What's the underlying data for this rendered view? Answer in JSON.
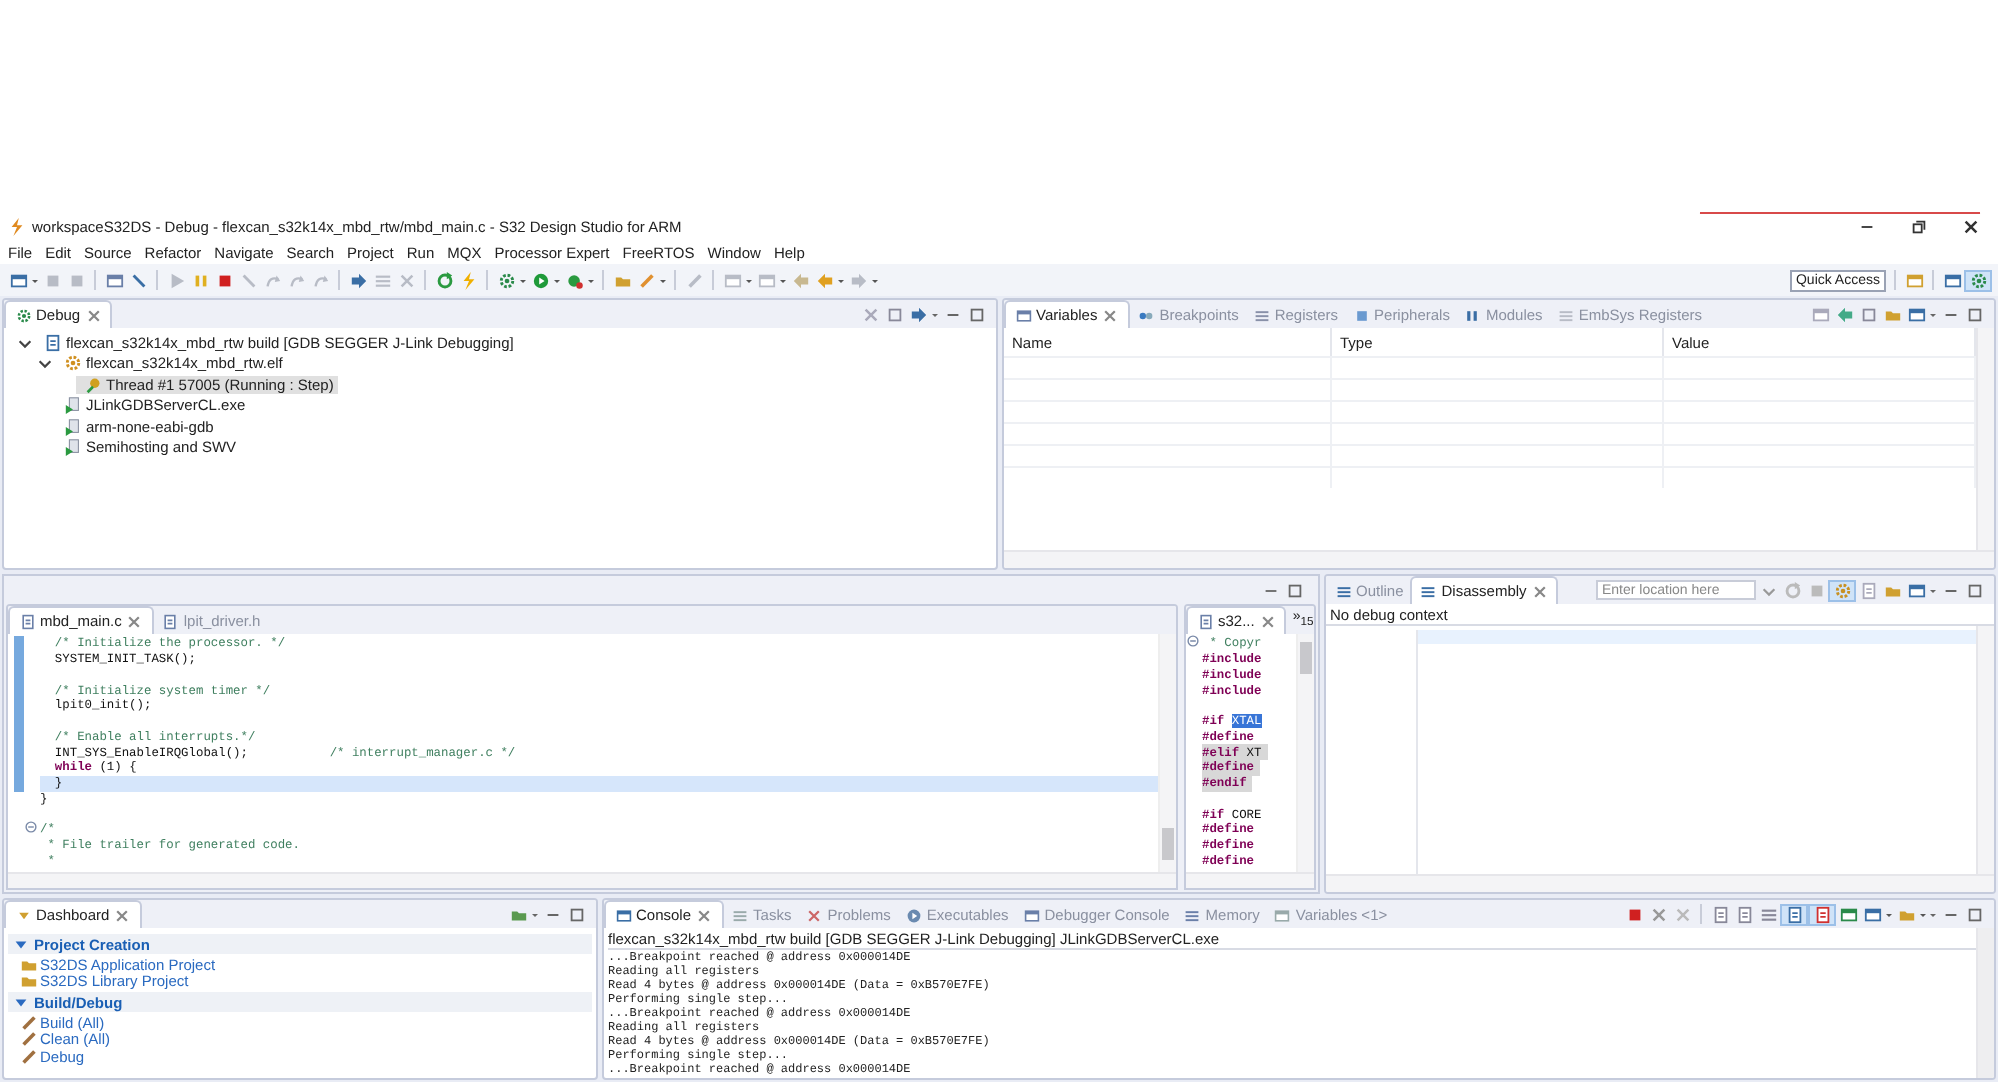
{
  "window": {
    "title": "workspaceS32DS - Debug - flexcan_s32k14x_mbd_rtw/mbd_main.c - S32 Design Studio for ARM"
  },
  "menu": [
    "File",
    "Edit",
    "Source",
    "Refactor",
    "Navigate",
    "Search",
    "Project",
    "Run",
    "MQX",
    "Processor Expert",
    "FreeRTOS",
    "Window",
    "Help"
  ],
  "toolbar": {
    "quick_access": "Quick Access"
  },
  "debug": {
    "tab": "Debug",
    "tree": [
      {
        "label": "flexcan_s32k14x_mbd_rtw build [GDB SEGGER J-Link Debugging]",
        "kind": "launch",
        "expanded": true,
        "selected": false,
        "children": [
          {
            "label": "flexcan_s32k14x_mbd_rtw.elf",
            "kind": "app",
            "expanded": true,
            "selected": false,
            "children": [
              {
                "label": "Thread #1 57005 (Running : Step)",
                "kind": "thread",
                "selected": true
              }
            ]
          },
          {
            "label": "JLinkGDBServerCL.exe",
            "kind": "process",
            "selected": false
          },
          {
            "label": "arm-none-eabi-gdb",
            "kind": "process",
            "selected": false
          },
          {
            "label": "Semihosting and SWV",
            "kind": "process",
            "selected": false
          }
        ]
      }
    ]
  },
  "variables": {
    "tabs": [
      {
        "label": "Variables",
        "selected": true
      },
      {
        "label": "Breakpoints",
        "selected": false
      },
      {
        "label": "Registers",
        "selected": false
      },
      {
        "label": "Peripherals",
        "selected": false
      },
      {
        "label": "Modules",
        "selected": false
      },
      {
        "label": "EmbSys Registers",
        "selected": false
      }
    ],
    "columns": [
      "Name",
      "Type",
      "Value"
    ]
  },
  "editor": {
    "tabs": [
      {
        "label": "mbd_main.c",
        "selected": true
      },
      {
        "label": "lpit_driver.h",
        "selected": false
      }
    ],
    "lines": [
      {
        "changed": true,
        "fold_marker": false,
        "highlighted": false,
        "segments": [
          {
            "text": "  /* Initialize the processor. */",
            "kind": "comment"
          }
        ]
      },
      {
        "changed": true,
        "fold_marker": false,
        "highlighted": false,
        "segments": [
          {
            "text": "  SYSTEM_INIT_TASK();",
            "kind": "plain"
          }
        ]
      },
      {
        "changed": true,
        "fold_marker": false,
        "highlighted": false
      },
      {
        "changed": true,
        "fold_marker": false,
        "highlighted": false,
        "segments": [
          {
            "text": "  /* Initialize system timer */",
            "kind": "comment"
          }
        ]
      },
      {
        "changed": true,
        "fold_marker": false,
        "highlighted": false,
        "segments": [
          {
            "text": "  lpit0_init();",
            "kind": "plain"
          }
        ]
      },
      {
        "changed": true,
        "fold_marker": false,
        "highlighted": false
      },
      {
        "changed": true,
        "fold_marker": false,
        "highlighted": false,
        "segments": [
          {
            "text": "  /* Enable all interrupts.*/",
            "kind": "comment"
          }
        ]
      },
      {
        "changed": true,
        "fold_marker": false,
        "highlighted": false,
        "segments": [
          {
            "text": "  INT_SYS_EnableIRQGlobal();           ",
            "kind": "plain"
          },
          {
            "text": "/* interrupt_manager.c */",
            "kind": "comment"
          }
        ]
      },
      {
        "changed": true,
        "fold_marker": false,
        "highlighted": false,
        "segments": [
          {
            "text": "  while",
            "kind": "keyword"
          },
          {
            "text": " (1) {",
            "kind": "plain"
          }
        ]
      },
      {
        "changed": true,
        "fold_marker": false,
        "highlighted": true,
        "segments": [
          {
            "text": "  }",
            "kind": "plain"
          }
        ]
      },
      {
        "changed": false,
        "fold_marker": false,
        "highlighted": false,
        "segments": [
          {
            "text": "}",
            "kind": "plain"
          }
        ]
      },
      {
        "changed": false,
        "fold_marker": false,
        "highlighted": false
      },
      {
        "changed": false,
        "fold_marker": true,
        "highlighted": false,
        "segments": [
          {
            "text": "/*",
            "kind": "comment"
          }
        ]
      },
      {
        "changed": false,
        "fold_marker": false,
        "highlighted": false,
        "segments": [
          {
            "text": " * File trailer for generated code.",
            "kind": "comment"
          }
        ]
      },
      {
        "changed": false,
        "fold_marker": false,
        "highlighted": false,
        "segments": [
          {
            "text": " *",
            "kind": "comment"
          }
        ]
      }
    ]
  },
  "side_editor": {
    "tabs": [
      {
        "label": "s32...",
        "selected": true
      }
    ],
    "overflow": "»$_{15}$",
    "lines": [
      {
        "inactive": false,
        "fold_marker": true,
        "segments": [
          {
            "text": " * Copyr",
            "kind": "comment"
          }
        ]
      },
      {
        "inactive": false,
        "fold_marker": false,
        "segments": [
          {
            "text": "#include",
            "kind": "keyword"
          }
        ]
      },
      {
        "inactive": false,
        "fold_marker": false,
        "segments": [
          {
            "text": "#include",
            "kind": "keyword"
          }
        ]
      },
      {
        "inactive": false,
        "fold_marker": false,
        "segments": [
          {
            "text": "#include",
            "kind": "keyword"
          }
        ]
      },
      {
        "inactive": false,
        "fold_marker": false
      },
      {
        "inactive": false,
        "fold_marker": false,
        "segments": [
          {
            "text": "#if ",
            "kind": "keyword"
          },
          {
            "text": "XTAL",
            "kind": "selection"
          }
        ]
      },
      {
        "inactive": false,
        "fold_marker": false,
        "segments": [
          {
            "text": "#define",
            "kind": "keyword"
          }
        ]
      },
      {
        "inactive": true,
        "fold_marker": false,
        "segments": [
          {
            "text": "#elif",
            "kind": "keyword"
          },
          {
            "text": " XT",
            "kind": "plain"
          }
        ]
      },
      {
        "inactive": true,
        "fold_marker": false,
        "segments": [
          {
            "text": "#define",
            "kind": "keyword"
          }
        ]
      },
      {
        "inactive": true,
        "fold_marker": false,
        "segments": [
          {
            "text": "#endif",
            "kind": "keyword"
          }
        ]
      },
      {
        "inactive": false,
        "fold_marker": false
      },
      {
        "inactive": false,
        "fold_marker": false,
        "segments": [
          {
            "text": "#if",
            "kind": "keyword"
          },
          {
            "text": " CORE",
            "kind": "plain"
          }
        ]
      },
      {
        "inactive": false,
        "fold_marker": false,
        "segments": [
          {
            "text": "#define",
            "kind": "keyword"
          }
        ]
      },
      {
        "inactive": false,
        "fold_marker": false,
        "segments": [
          {
            "text": "#define",
            "kind": "keyword"
          }
        ]
      },
      {
        "inactive": false,
        "fold_marker": false,
        "segments": [
          {
            "text": "#define",
            "kind": "keyword"
          }
        ]
      }
    ]
  },
  "disassembly": {
    "tabs": [
      {
        "label": "Outline",
        "selected": false
      },
      {
        "label": "Disassembly",
        "selected": true
      }
    ],
    "location": {
      "placeholder": "Enter location here"
    },
    "message": "No debug context"
  },
  "dashboard": {
    "tab": "Dashboard",
    "sections": [
      {
        "title": "Project Creation",
        "expanded": true,
        "items": [
          "S32DS Application Project",
          "S32DS Library Project"
        ]
      },
      {
        "title": "Build/Debug",
        "expanded": true,
        "items": [
          "Build  (All)",
          "Clean  (All)",
          "Debug"
        ]
      }
    ]
  },
  "console": {
    "tabs": [
      {
        "label": "Console",
        "selected": true
      },
      {
        "label": "Tasks",
        "selected": false
      },
      {
        "label": "Problems",
        "selected": false
      },
      {
        "label": "Executables",
        "selected": false
      },
      {
        "label": "Debugger Console",
        "selected": false
      },
      {
        "label": "Memory",
        "selected": false
      },
      {
        "label": "Variables <1>",
        "selected": false
      }
    ],
    "process": "flexcan_s32k14x_mbd_rtw build [GDB SEGGER J-Link Debugging] JLinkGDBServerCL.exe",
    "lines": [
      "...Breakpoint reached @ address 0x000014DE",
      "Reading all registers",
      "Read 4 bytes @ address 0x000014DE (Data = 0xB570E7FE)",
      "Performing single step...",
      "...Breakpoint reached @ address 0x000014DE",
      "Reading all registers",
      "Read 4 bytes @ address 0x000014DE (Data = 0xB570E7FE)",
      "Performing single step...",
      "...Breakpoint reached @ address 0x000014DE"
    ]
  }
}
